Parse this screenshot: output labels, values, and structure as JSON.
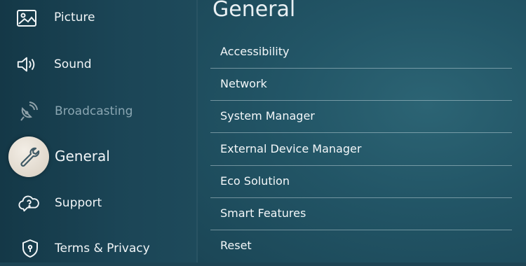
{
  "sidebar": {
    "items": [
      {
        "label": "Picture",
        "icon": "picture-icon"
      },
      {
        "label": "Sound",
        "icon": "speaker-icon"
      },
      {
        "label": "Broadcasting",
        "icon": "satellite-icon",
        "state": "disabled"
      },
      {
        "label": "General",
        "icon": "wrench-icon",
        "state": "selected"
      },
      {
        "label": "Support",
        "icon": "cloud-question-icon"
      },
      {
        "label": "Terms & Privacy",
        "icon": "shield-icon"
      }
    ]
  },
  "main": {
    "title": "General",
    "items": [
      {
        "label": "Accessibility"
      },
      {
        "label": "Network"
      },
      {
        "label": "System Manager"
      },
      {
        "label": "External Device Manager"
      },
      {
        "label": "Eco Solution"
      },
      {
        "label": "Smart Features"
      },
      {
        "label": "Reset"
      }
    ]
  },
  "colors": {
    "sidebar_bg": "#1b4556",
    "panel_bg": "#225566",
    "selected_bubble": "#e8e1d6",
    "text": "#f1f5f7",
    "disabled_text": "#8aa6b2"
  }
}
